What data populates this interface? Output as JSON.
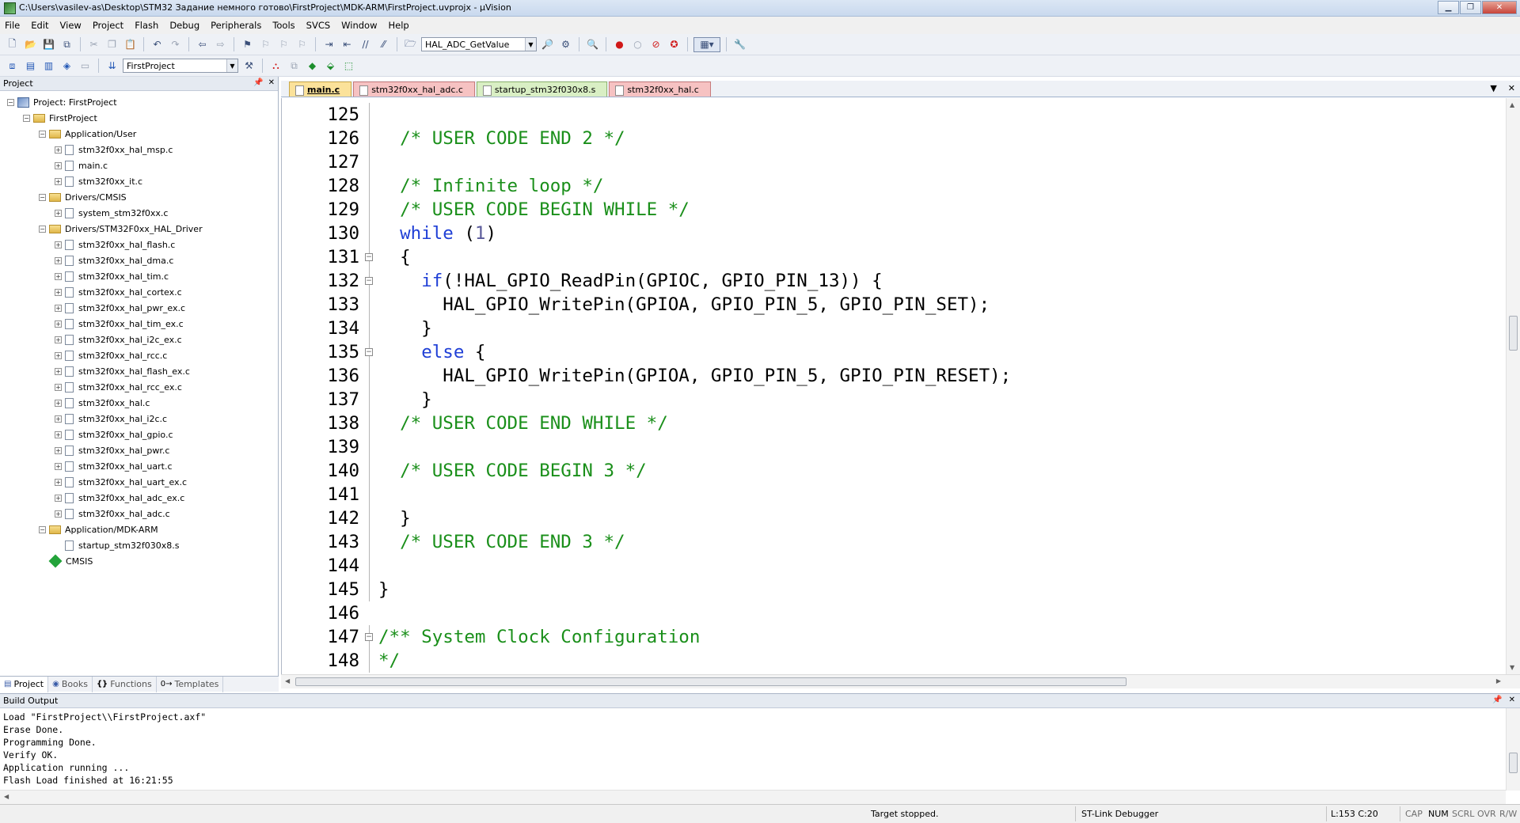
{
  "window": {
    "title": "C:\\Users\\vasilev-as\\Desktop\\STM32 Задание немного готово\\FirstProject\\MDK-ARM\\FirstProject.uvprojx - µVision"
  },
  "menu": [
    "File",
    "Edit",
    "View",
    "Project",
    "Flash",
    "Debug",
    "Peripherals",
    "Tools",
    "SVCS",
    "Window",
    "Help"
  ],
  "toolbar": {
    "find_combo_value": "HAL_ADC_GetValue",
    "target_combo_value": "FirstProject"
  },
  "project_panel": {
    "header": "Project",
    "tree": [
      {
        "label": "Project: FirstProject",
        "type": "project",
        "level": 0,
        "expander": "−"
      },
      {
        "label": "FirstProject",
        "type": "target",
        "level": 1,
        "expander": "−"
      },
      {
        "label": "Application/User",
        "type": "folder",
        "level": 2,
        "expander": "−"
      },
      {
        "label": "stm32f0xx_hal_msp.c",
        "type": "file",
        "level": 3,
        "expander": "+"
      },
      {
        "label": "main.c",
        "type": "file",
        "level": 3,
        "expander": "+"
      },
      {
        "label": "stm32f0xx_it.c",
        "type": "file",
        "level": 3,
        "expander": "+"
      },
      {
        "label": "Drivers/CMSIS",
        "type": "folder",
        "level": 2,
        "expander": "−"
      },
      {
        "label": "system_stm32f0xx.c",
        "type": "file",
        "level": 3,
        "expander": "+"
      },
      {
        "label": "Drivers/STM32F0xx_HAL_Driver",
        "type": "folder",
        "level": 2,
        "expander": "−"
      },
      {
        "label": "stm32f0xx_hal_flash.c",
        "type": "file",
        "level": 3,
        "expander": "+"
      },
      {
        "label": "stm32f0xx_hal_dma.c",
        "type": "file",
        "level": 3,
        "expander": "+"
      },
      {
        "label": "stm32f0xx_hal_tim.c",
        "type": "file",
        "level": 3,
        "expander": "+"
      },
      {
        "label": "stm32f0xx_hal_cortex.c",
        "type": "file",
        "level": 3,
        "expander": "+"
      },
      {
        "label": "stm32f0xx_hal_pwr_ex.c",
        "type": "file",
        "level": 3,
        "expander": "+"
      },
      {
        "label": "stm32f0xx_hal_tim_ex.c",
        "type": "file",
        "level": 3,
        "expander": "+"
      },
      {
        "label": "stm32f0xx_hal_i2c_ex.c",
        "type": "file",
        "level": 3,
        "expander": "+"
      },
      {
        "label": "stm32f0xx_hal_rcc.c",
        "type": "file",
        "level": 3,
        "expander": "+"
      },
      {
        "label": "stm32f0xx_hal_flash_ex.c",
        "type": "file",
        "level": 3,
        "expander": "+"
      },
      {
        "label": "stm32f0xx_hal_rcc_ex.c",
        "type": "file",
        "level": 3,
        "expander": "+"
      },
      {
        "label": "stm32f0xx_hal.c",
        "type": "file",
        "level": 3,
        "expander": "+"
      },
      {
        "label": "stm32f0xx_hal_i2c.c",
        "type": "file",
        "level": 3,
        "expander": "+"
      },
      {
        "label": "stm32f0xx_hal_gpio.c",
        "type": "file",
        "level": 3,
        "expander": "+"
      },
      {
        "label": "stm32f0xx_hal_pwr.c",
        "type": "file",
        "level": 3,
        "expander": "+"
      },
      {
        "label": "stm32f0xx_hal_uart.c",
        "type": "file",
        "level": 3,
        "expander": "+"
      },
      {
        "label": "stm32f0xx_hal_uart_ex.c",
        "type": "file",
        "level": 3,
        "expander": "+"
      },
      {
        "label": "stm32f0xx_hal_adc_ex.c",
        "type": "file",
        "level": 3,
        "expander": "+"
      },
      {
        "label": "stm32f0xx_hal_adc.c",
        "type": "file",
        "level": 3,
        "expander": "+"
      },
      {
        "label": "Application/MDK-ARM",
        "type": "folder",
        "level": 2,
        "expander": "−"
      },
      {
        "label": "startup_stm32f030x8.s",
        "type": "file",
        "level": 3,
        "expander": ""
      },
      {
        "label": "CMSIS",
        "type": "cmsis",
        "level": 2,
        "expander": ""
      }
    ],
    "tabs": [
      {
        "label": "Project",
        "icon": "▤",
        "active": true
      },
      {
        "label": "Books",
        "icon": "◉",
        "active": false
      },
      {
        "label": "Functions",
        "icon": "{}",
        "active": false
      },
      {
        "label": "Templates",
        "icon": "0→",
        "active": false
      }
    ]
  },
  "editor": {
    "tabs": [
      {
        "label": "main.c",
        "style": "active"
      },
      {
        "label": "stm32f0xx_hal_adc.c",
        "style": "red"
      },
      {
        "label": "startup_stm32f030x8.s",
        "style": "green"
      },
      {
        "label": "stm32f0xx_hal.c",
        "style": "red"
      }
    ],
    "lines": [
      {
        "n": "125",
        "fold": "line",
        "segs": []
      },
      {
        "n": "126",
        "fold": "line",
        "segs": [
          {
            "t": "  "
          },
          {
            "t": "/* USER CODE END 2 */",
            "c": "cm"
          }
        ]
      },
      {
        "n": "127",
        "fold": "line",
        "segs": []
      },
      {
        "n": "128",
        "fold": "line",
        "segs": [
          {
            "t": "  "
          },
          {
            "t": "/* Infinite loop */",
            "c": "cm"
          }
        ]
      },
      {
        "n": "129",
        "fold": "line",
        "segs": [
          {
            "t": "  "
          },
          {
            "t": "/* USER CODE BEGIN WHILE */",
            "c": "cm"
          }
        ]
      },
      {
        "n": "130",
        "fold": "line",
        "segs": [
          {
            "t": "  "
          },
          {
            "t": "while",
            "c": "kw"
          },
          {
            "t": " ("
          },
          {
            "t": "1",
            "c": "num"
          },
          {
            "t": ")"
          }
        ]
      },
      {
        "n": "131",
        "fold": "box",
        "segs": [
          {
            "t": "  {"
          }
        ]
      },
      {
        "n": "132",
        "fold": "box",
        "segs": [
          {
            "t": "    "
          },
          {
            "t": "if",
            "c": "kw"
          },
          {
            "t": "(!HAL_GPIO_ReadPin(GPIOC, GPIO_PIN_13)) {"
          }
        ]
      },
      {
        "n": "133",
        "fold": "line",
        "segs": [
          {
            "t": "      HAL_GPIO_WritePin(GPIOA, GPIO_PIN_5, GPIO_PIN_SET);"
          }
        ]
      },
      {
        "n": "134",
        "fold": "line",
        "segs": [
          {
            "t": "    }"
          }
        ]
      },
      {
        "n": "135",
        "fold": "box",
        "segs": [
          {
            "t": "    "
          },
          {
            "t": "else",
            "c": "kw"
          },
          {
            "t": " {"
          }
        ]
      },
      {
        "n": "136",
        "fold": "line",
        "segs": [
          {
            "t": "      HAL_GPIO_WritePin(GPIOA, GPIO_PIN_5, GPIO_PIN_RESET);"
          }
        ]
      },
      {
        "n": "137",
        "fold": "line",
        "segs": [
          {
            "t": "    }"
          }
        ]
      },
      {
        "n": "138",
        "fold": "line",
        "segs": [
          {
            "t": "  "
          },
          {
            "t": "/* USER CODE END WHILE */",
            "c": "cm"
          }
        ]
      },
      {
        "n": "139",
        "fold": "line",
        "segs": []
      },
      {
        "n": "140",
        "fold": "line",
        "segs": [
          {
            "t": "  "
          },
          {
            "t": "/* USER CODE BEGIN 3 */",
            "c": "cm"
          }
        ]
      },
      {
        "n": "141",
        "fold": "line",
        "segs": []
      },
      {
        "n": "142",
        "fold": "line",
        "segs": [
          {
            "t": "  }"
          }
        ]
      },
      {
        "n": "143",
        "fold": "line",
        "segs": [
          {
            "t": "  "
          },
          {
            "t": "/* USER CODE END 3 */",
            "c": "cm"
          }
        ]
      },
      {
        "n": "144",
        "fold": "line",
        "segs": []
      },
      {
        "n": "145",
        "fold": "line",
        "segs": [
          {
            "t": "}"
          }
        ]
      },
      {
        "n": "146",
        "fold": "none",
        "segs": []
      },
      {
        "n": "147",
        "fold": "box",
        "segs": [
          {
            "t": "/** System Clock Configuration",
            "c": "cm"
          }
        ]
      },
      {
        "n": "148",
        "fold": "line",
        "segs": [
          {
            "t": "*/",
            "c": "cm"
          }
        ]
      }
    ]
  },
  "build_output": {
    "header": "Build Output",
    "lines": [
      "Load \"FirstProject\\\\FirstProject.axf\"",
      "Erase Done.",
      "Programming Done.",
      "Verify OK.",
      "Application running ...",
      "Flash Load finished at 16:21:55"
    ]
  },
  "status": {
    "target_state": "Target stopped.",
    "debugger": "ST-Link Debugger",
    "cursor": "L:153 C:20",
    "caps": "CAP",
    "num": "NUM",
    "scrl": "SCRL",
    "ovr": "OVR",
    "rw": "R/W"
  }
}
